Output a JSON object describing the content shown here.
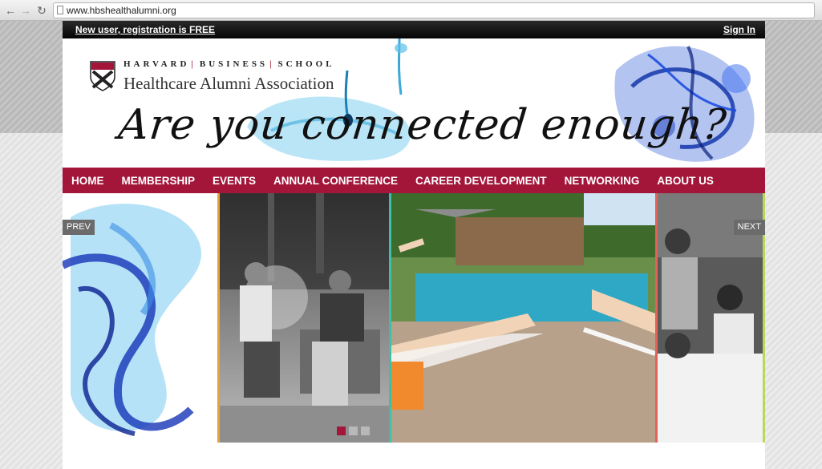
{
  "browser": {
    "url": "www.hbshealthalumni.org",
    "back_glyph": "←",
    "forward_glyph": "→",
    "reload_glyph": "↻"
  },
  "topbar": {
    "register_link": "New user, registration is FREE",
    "signin_link": "Sign In"
  },
  "header": {
    "school_words": [
      "HARVARD",
      "BUSINESS",
      "SCHOOL"
    ],
    "association_name": "Healthcare Alumni Association",
    "tagline": "Are you connected enough?",
    "brand_color": "#a3163a"
  },
  "nav": {
    "items": [
      {
        "label": "HOME"
      },
      {
        "label": "MEMBERSHIP"
      },
      {
        "label": "EVENTS"
      },
      {
        "label": "ANNUAL CONFERENCE"
      },
      {
        "label": "CAREER DEVELOPMENT"
      },
      {
        "label": "NETWORKING"
      },
      {
        "label": "ABOUT US"
      }
    ]
  },
  "slider": {
    "prev_label": "PREV",
    "next_label": "NEXT",
    "slide_count": 3,
    "active_slide": 1,
    "border_colors": [
      "#e7a33a",
      "#3dbfa8",
      "#e2625a",
      "#b7d85a"
    ]
  },
  "icons": [
    "back-arrow-icon",
    "forward-arrow-icon",
    "reload-icon",
    "page-icon",
    "hbs-shield-icon"
  ]
}
